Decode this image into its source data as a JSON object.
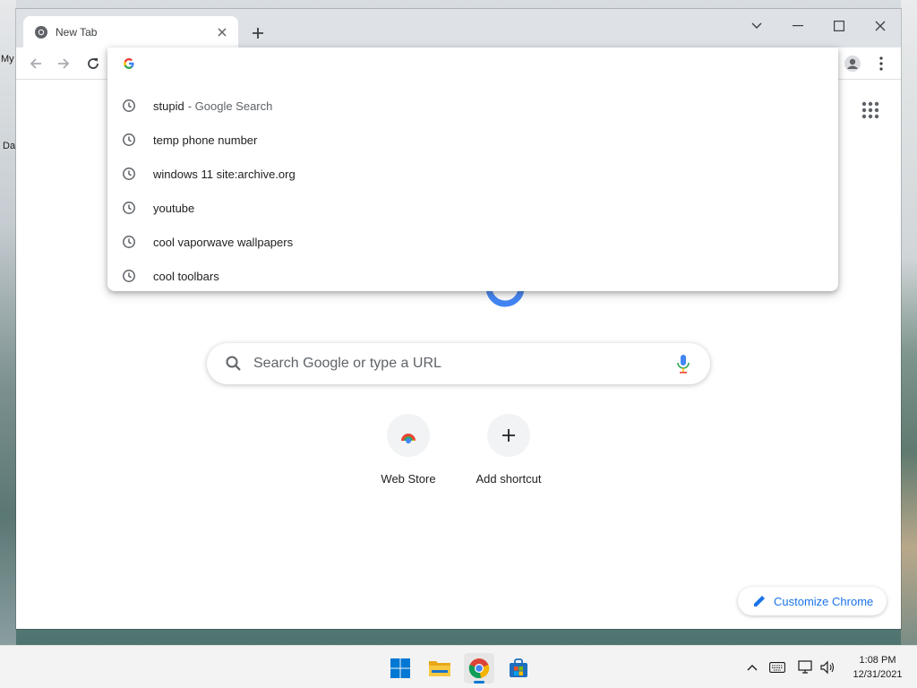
{
  "desktop": {
    "labels": [
      "My",
      "Da"
    ]
  },
  "browser": {
    "tab_title": "New Tab",
    "omnibox": {
      "suggestions": [
        {
          "text": "stupid",
          "description": "- Google Search"
        },
        {
          "text": "temp phone number",
          "description": ""
        },
        {
          "text": "windows 11 site:archive.org",
          "description": ""
        },
        {
          "text": "youtube",
          "description": ""
        },
        {
          "text": "cool vaporwave wallpapers",
          "description": ""
        },
        {
          "text": "cool toolbars",
          "description": ""
        }
      ]
    },
    "ntp": {
      "search_placeholder": "Search Google or type a URL",
      "shortcuts": [
        {
          "label": "Web Store",
          "icon": "web-store-icon"
        },
        {
          "label": "Add shortcut",
          "icon": "plus-icon"
        }
      ],
      "customize_label": "Customize Chrome"
    },
    "colors": {
      "accent": "#1a73e8",
      "titlebar": "#dee1e6"
    }
  },
  "taskbar": {
    "apps": [
      "start-icon",
      "file-explorer-icon",
      "chrome-icon",
      "store-icon"
    ],
    "time": "1:08 PM",
    "date": "12/31/2021"
  }
}
